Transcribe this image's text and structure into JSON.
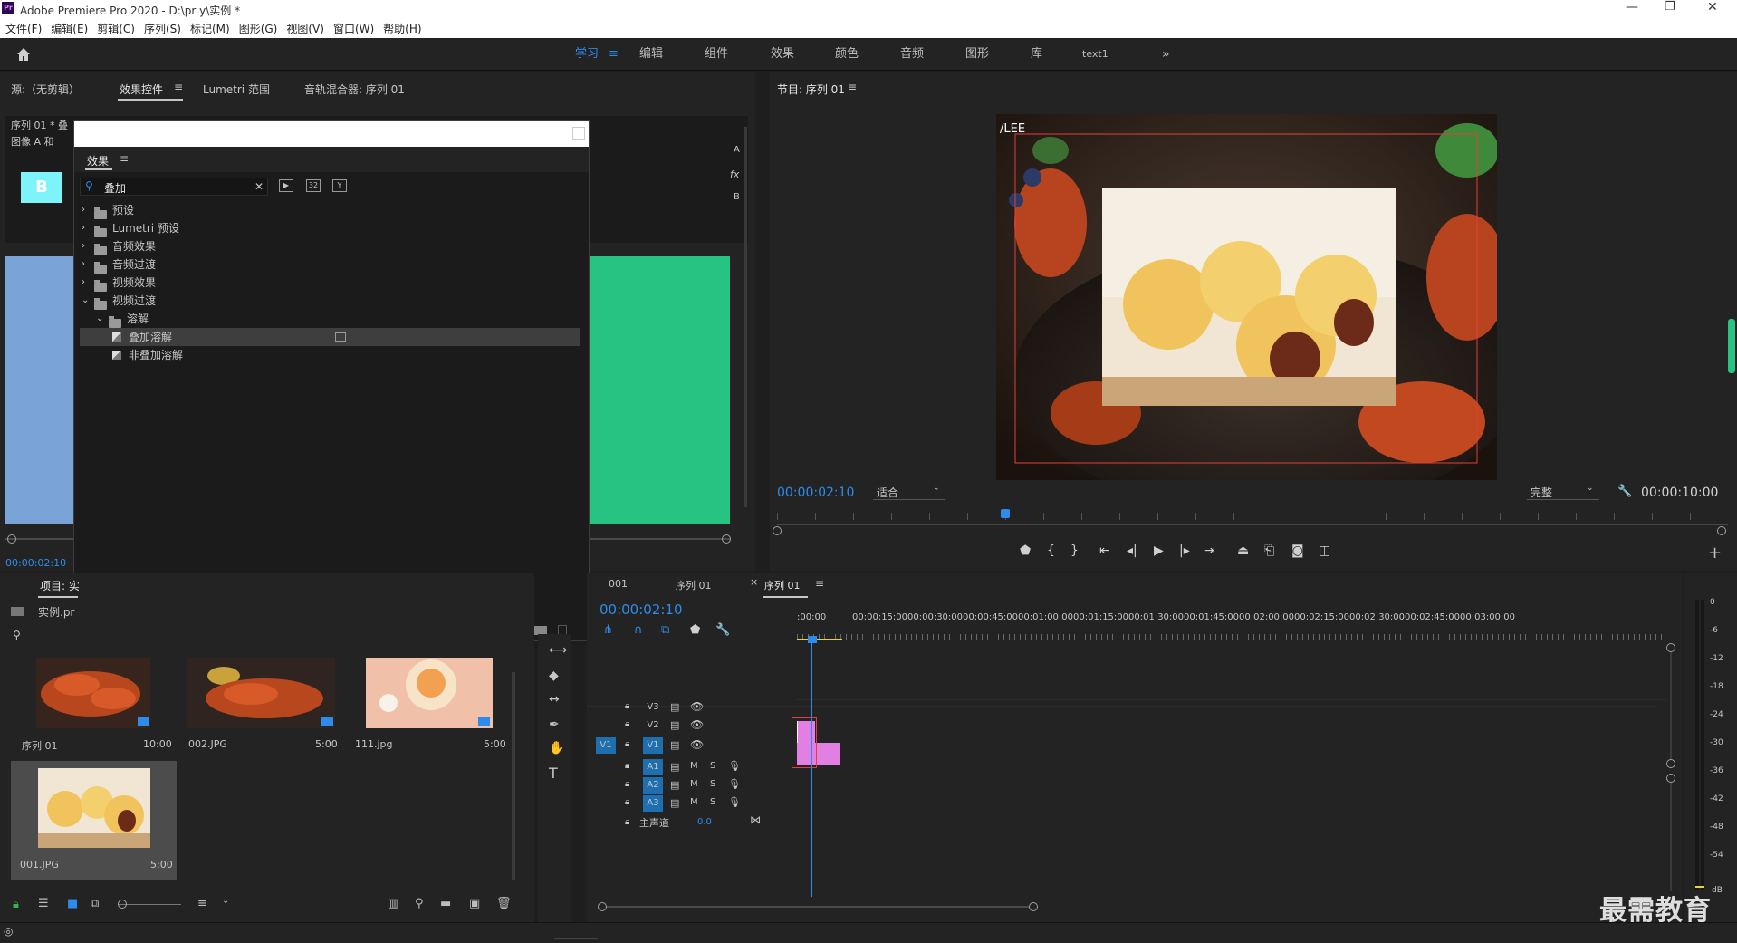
{
  "window": {
    "title": "Adobe Premiere Pro 2020 - D:\\pr y\\实例 *",
    "app_badge": "Pr"
  },
  "menu": [
    "文件(F)",
    "编辑(E)",
    "剪辑(C)",
    "序列(S)",
    "标记(M)",
    "图形(G)",
    "视图(V)",
    "窗口(W)",
    "帮助(H)"
  ],
  "workspaces": [
    "学习",
    "编辑",
    "组件",
    "效果",
    "颜色",
    "音频",
    "图形",
    "库",
    "text1"
  ],
  "source_panel": {
    "tabs": [
      "源:（无剪辑）",
      "效果控件",
      "Lumetri 范围",
      "音轨混合器: 序列 01"
    ],
    "seq_label": "序列 01 * 叠",
    "clip_label": "图像 A 和",
    "timecode": "00:00:02:10",
    "side_labels": [
      "A",
      "fx",
      "B"
    ]
  },
  "effects_panel": {
    "title": "效果",
    "search_value": "叠加",
    "tree": [
      {
        "label": "预设",
        "expanded": false,
        "level": 0
      },
      {
        "label": "Lumetri 预设",
        "expanded": false,
        "level": 0
      },
      {
        "label": "音频效果",
        "expanded": false,
        "level": 0
      },
      {
        "label": "音频过渡",
        "expanded": false,
        "level": 0
      },
      {
        "label": "视频效果",
        "expanded": false,
        "level": 0
      },
      {
        "label": "视频过渡",
        "expanded": true,
        "level": 0
      },
      {
        "label": "溶解",
        "expanded": true,
        "level": 1
      },
      {
        "label": "叠加溶解",
        "level": 2,
        "selected": true
      },
      {
        "label": "非叠加溶解",
        "level": 2
      }
    ]
  },
  "program_monitor": {
    "title": "节目: 序列 01",
    "timecode": "00:00:02:10",
    "fit": "适合",
    "quality": "完整",
    "duration": "00:00:10:00",
    "watermark_text": "/LEE",
    "playhead_fraction": 0.24
  },
  "project_panel": {
    "tab": "项目: 实",
    "item_label": "实例.pr",
    "items": [
      {
        "name": "序列 01",
        "duration": "10:00"
      },
      {
        "name": "002.JPG",
        "duration": "5:00"
      },
      {
        "name": "111.jpg",
        "duration": "5:00"
      },
      {
        "name": "001.JPG",
        "duration": "5:00"
      }
    ]
  },
  "timeline": {
    "tabs": [
      "001",
      "序列 01",
      "序列 01"
    ],
    "timecode": "00:00:02:10",
    "ruler": [
      ":00:00",
      "00:00:15:00",
      "00:00:30:00",
      "00:00:45:00",
      "00:01:00:00",
      "00:01:15:00",
      "00:01:30:00",
      "00:01:45:00",
      "00:02:00:00",
      "00:02:15:00",
      "00:02:30:00",
      "00:02:45:00",
      "00:03:00:00"
    ],
    "video_tracks": [
      "V3",
      "V2",
      "V1"
    ],
    "source_patch": "V1",
    "audio_tracks": [
      "A1",
      "A2",
      "A3"
    ],
    "mute": "M",
    "solo": "S",
    "master_label": "主声道",
    "master_value": "0.0"
  },
  "meter": {
    "scale": [
      "0",
      "-6",
      "-12",
      "-18",
      "-24",
      "-30",
      "-36",
      "-42",
      "-48",
      "-54"
    ],
    "unit": "dB"
  },
  "brand": "最需教育",
  "colors": {
    "accent": "#2d8ceb",
    "clip": "#e17fe3",
    "track_patch": "#1e6fb0"
  }
}
